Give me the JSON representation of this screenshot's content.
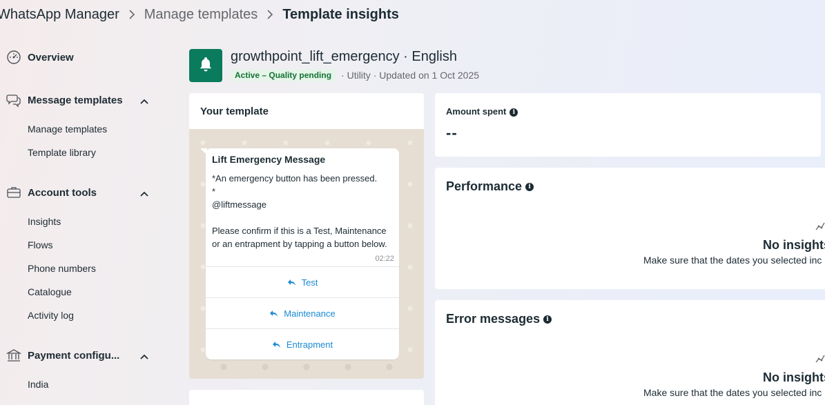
{
  "breadcrumb": {
    "items": [
      "WhatsApp Manager",
      "Manage templates",
      "Template insights"
    ]
  },
  "sidebar": {
    "overview": {
      "label": "Overview",
      "icon": "dashboard-icon"
    },
    "message_templates": {
      "label": "Message templates",
      "icon": "chat-bubbles-icon",
      "items": [
        "Manage templates",
        "Template library"
      ]
    },
    "account_tools": {
      "label": "Account tools",
      "icon": "briefcase-icon",
      "items": [
        "Insights",
        "Flows",
        "Phone numbers",
        "Catalogue",
        "Activity log"
      ]
    },
    "payment": {
      "label": "Payment configu...",
      "icon": "bank-icon",
      "items": [
        "India"
      ]
    }
  },
  "template": {
    "name": "growthpoint_lift_emergency · English",
    "status": "Active – Quality pending",
    "meta": "· Utility · Updated on 1 Oct 2025",
    "badge_color": "#0a7b5c"
  },
  "preview_card": {
    "title": "Your template",
    "message": {
      "header": "Lift Emergency Message",
      "body": "*An emergency button has been pressed.\n*\n@liftmessage\n\nPlease confirm if this is a Test, Maintenance or an entrapment by tapping a button below.",
      "time": "02:22",
      "buttons": [
        "Test",
        "Maintenance",
        "Entrapment"
      ]
    }
  },
  "amount_card": {
    "title": "Amount spent",
    "value": "--"
  },
  "performance_card": {
    "title": "Performance",
    "empty_title": "No insights",
    "empty_sub": "Make sure that the dates you selected inc"
  },
  "errors_card": {
    "title": "Error messages",
    "empty_title": "No insights",
    "empty_sub": "Make sure that the dates you selected inc"
  },
  "colors": {
    "accent_link": "#1a8ad4",
    "status_green": "#137333",
    "status_bg": "#e6f4ea"
  }
}
